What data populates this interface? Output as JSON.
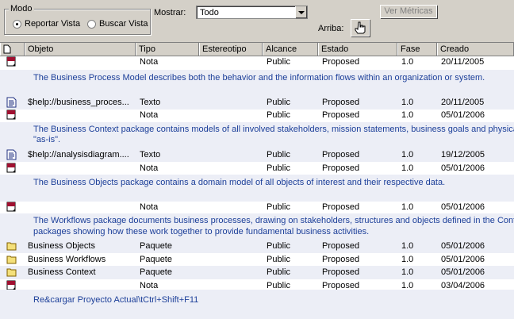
{
  "toolbar": {
    "modo_label": "Modo",
    "radio_reportar": "Reportar Vista",
    "radio_buscar": "Buscar Vista",
    "mostrar_label": "Mostrar:",
    "mostrar_value": "Todo",
    "ver_metricas": "Ver Métricas",
    "arriba_label": "Arriba:"
  },
  "columns": [
    "Objeto",
    "Tipo",
    "Estereotipo",
    "Alcance",
    "Estado",
    "Fase",
    "Creado"
  ],
  "rows": [
    {
      "icon": "note-icon",
      "objeto": "",
      "tipo": "Nota",
      "alcance": "Public",
      "estado": "Proposed",
      "fase": "1.0",
      "creado": "20/11/2005"
    },
    {
      "icon": "text-doc-icon",
      "objeto": "$help://business_proces...",
      "tipo": "Texto",
      "alcance": "Public",
      "estado": "Proposed",
      "fase": "1.0",
      "creado": "20/11/2005"
    },
    {
      "icon": "note-icon",
      "objeto": "",
      "tipo": "Nota",
      "alcance": "Public",
      "estado": "Proposed",
      "fase": "1.0",
      "creado": "05/01/2006"
    },
    {
      "icon": "text-doc-icon",
      "objeto": "$help://analysisdiagram....",
      "tipo": "Texto",
      "alcance": "Public",
      "estado": "Proposed",
      "fase": "1.0",
      "creado": "19/12/2005"
    },
    {
      "icon": "note-icon",
      "objeto": "",
      "tipo": "Nota",
      "alcance": "Public",
      "estado": "Proposed",
      "fase": "1.0",
      "creado": "05/01/2006"
    },
    {
      "icon": "note-icon",
      "objeto": "",
      "tipo": "Nota",
      "alcance": "Public",
      "estado": "Proposed",
      "fase": "1.0",
      "creado": "05/01/2006"
    },
    {
      "icon": "folder-icon",
      "objeto": "Business Objects",
      "tipo": "Paquete",
      "alcance": "Public",
      "estado": "Proposed",
      "fase": "1.0",
      "creado": "05/01/2006"
    },
    {
      "icon": "folder-icon",
      "objeto": "Business Workflows",
      "tipo": "Paquete",
      "alcance": "Public",
      "estado": "Proposed",
      "fase": "1.0",
      "creado": "05/01/2006"
    },
    {
      "icon": "folder-icon",
      "objeto": "Business Context",
      "tipo": "Paquete",
      "alcance": "Public",
      "estado": "Proposed",
      "fase": "1.0",
      "creado": "05/01/2006"
    },
    {
      "icon": "note-icon",
      "objeto": "",
      "tipo": "Nota",
      "alcance": "Public",
      "estado": "Proposed",
      "fase": "1.0",
      "creado": "03/04/2006"
    }
  ],
  "notes": [
    "The Business Process Model describes both the behavior and the information flows within an organization or system.",
    "The Business Context package contains models of all involved stakeholders, mission statements, business goals and physical stru",
    "\"as-is\".",
    "The Business Objects package contains a domain model of all objects of interest and their respective data.",
    "The Workflows package documents business processes, drawing on stakeholders, structures and objects defined in the Context",
    "packages showing how these work together to provide fundamental business activities.",
    "Re&cargar Proyecto Actual\\tCtrl+Shift+F11"
  ]
}
